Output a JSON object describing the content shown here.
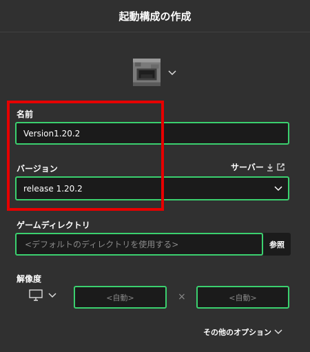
{
  "header": {
    "title": "起動構成の作成"
  },
  "icon_picker": {
    "icon": "furnace-icon",
    "chevron": "chevron-down-icon"
  },
  "name_field": {
    "label": "名前",
    "value": "Version1.20.2"
  },
  "version_field": {
    "label": "バージョン",
    "value": "release 1.20.2",
    "server_link": "サーバー"
  },
  "game_dir": {
    "label": "ゲームディレクトリ",
    "placeholder": "<デフォルトのディレクトリを使用する>",
    "browse": "参照"
  },
  "resolution": {
    "label": "解像度",
    "width_placeholder": "<自動>",
    "height_placeholder": "<自動>",
    "separator": "×"
  },
  "more_options": {
    "label": "その他のオプション"
  },
  "colors": {
    "background": "#303030",
    "field": "#1b1b1b",
    "accent": "#3bd16f",
    "highlight": "#e60000"
  }
}
